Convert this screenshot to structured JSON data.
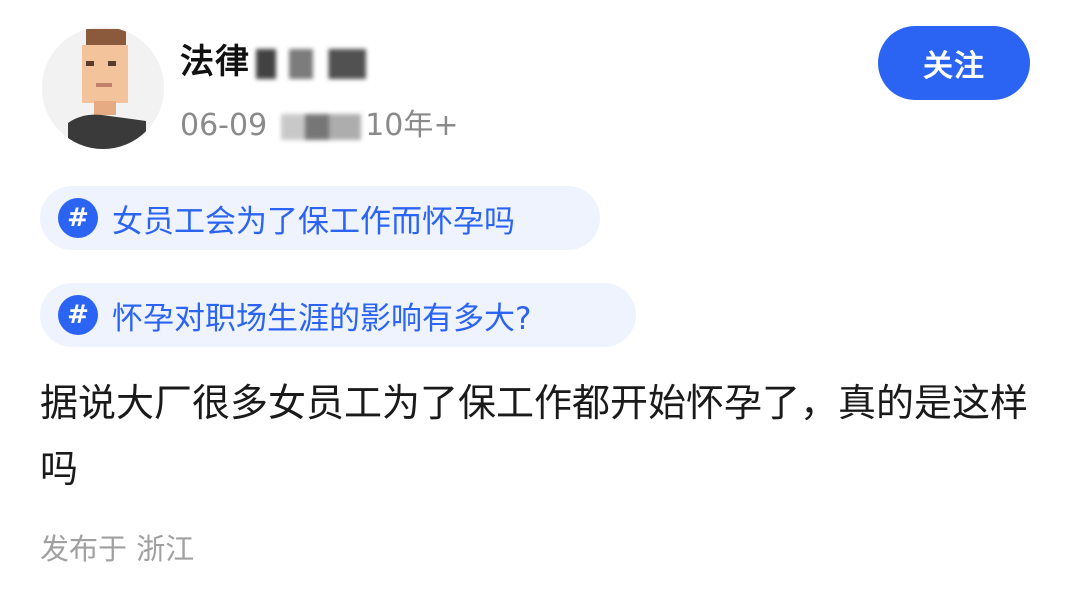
{
  "author": {
    "name_visible": "法律",
    "meta_date": "06-09",
    "meta_suffix": "10年+"
  },
  "follow_button": {
    "label": "关注"
  },
  "topics": [
    {
      "label": "女员工会为了保工作而怀孕吗"
    },
    {
      "label": "怀孕对职场生涯的影响有多大?"
    }
  ],
  "post": {
    "text": "据说大厂很多女员工为了保工作都开始怀孕了，真的是这样吗",
    "location": "发布于 浙江"
  },
  "colors": {
    "accent": "#2b63f3",
    "tag_bg": "#eef3fd",
    "meta_text": "#8a8a8a",
    "location_text": "#a0a0a0"
  },
  "icons": {
    "avatar": "cartoon-person-avatar",
    "topic": "hashtag-icon"
  }
}
